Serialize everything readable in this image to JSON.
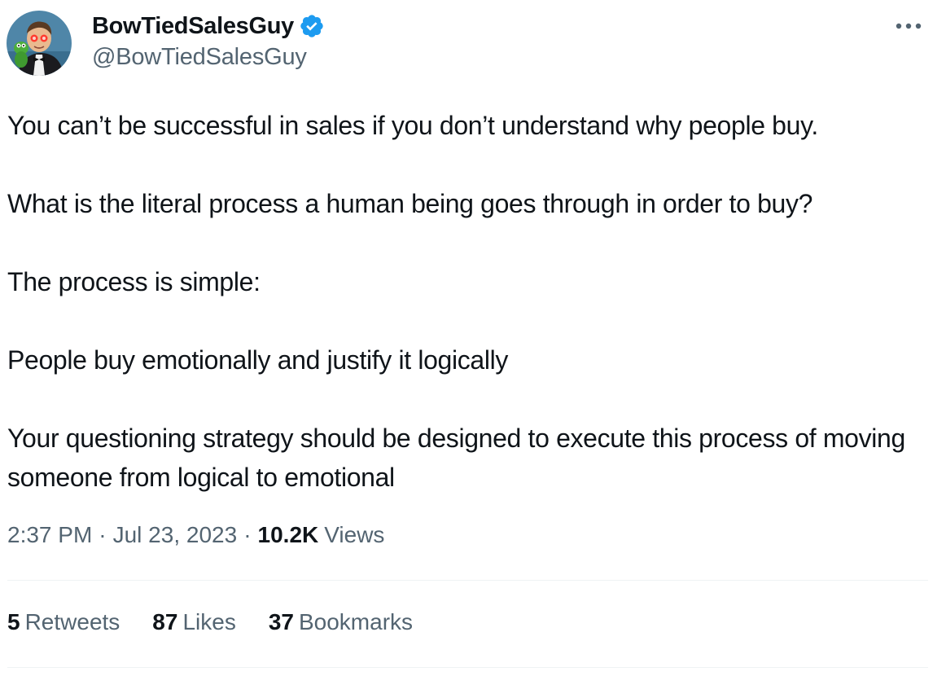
{
  "author": {
    "display_name": "BowTiedSalesGuy",
    "handle": "@BowTiedSalesGuy",
    "verified_icon": "verified-badge-icon",
    "avatar_icon": "avatar-image"
  },
  "header": {
    "more_icon": "more-options-icon"
  },
  "tweet": {
    "paragraphs": [
      "You can’t be successful in sales if you don’t understand why people buy.",
      "What is the literal process a human being goes through in order to buy?",
      "The process is simple:",
      "People buy emotionally and justify it logically",
      "Your questioning strategy should be designed to execute this process of moving someone from logical to emotional"
    ]
  },
  "meta": {
    "time": "2:37 PM",
    "separator": "·",
    "date": "Jul 23, 2023",
    "views_count": "10.2K",
    "views_label": "Views"
  },
  "stats": {
    "retweets": {
      "count": "5",
      "label": "Retweets"
    },
    "likes": {
      "count": "87",
      "label": "Likes"
    },
    "bookmarks": {
      "count": "37",
      "label": "Bookmarks"
    }
  },
  "colors": {
    "text_primary": "#0f1419",
    "text_secondary": "#536471",
    "verified_blue": "#1d9bf0",
    "divider": "#eff3f4"
  }
}
